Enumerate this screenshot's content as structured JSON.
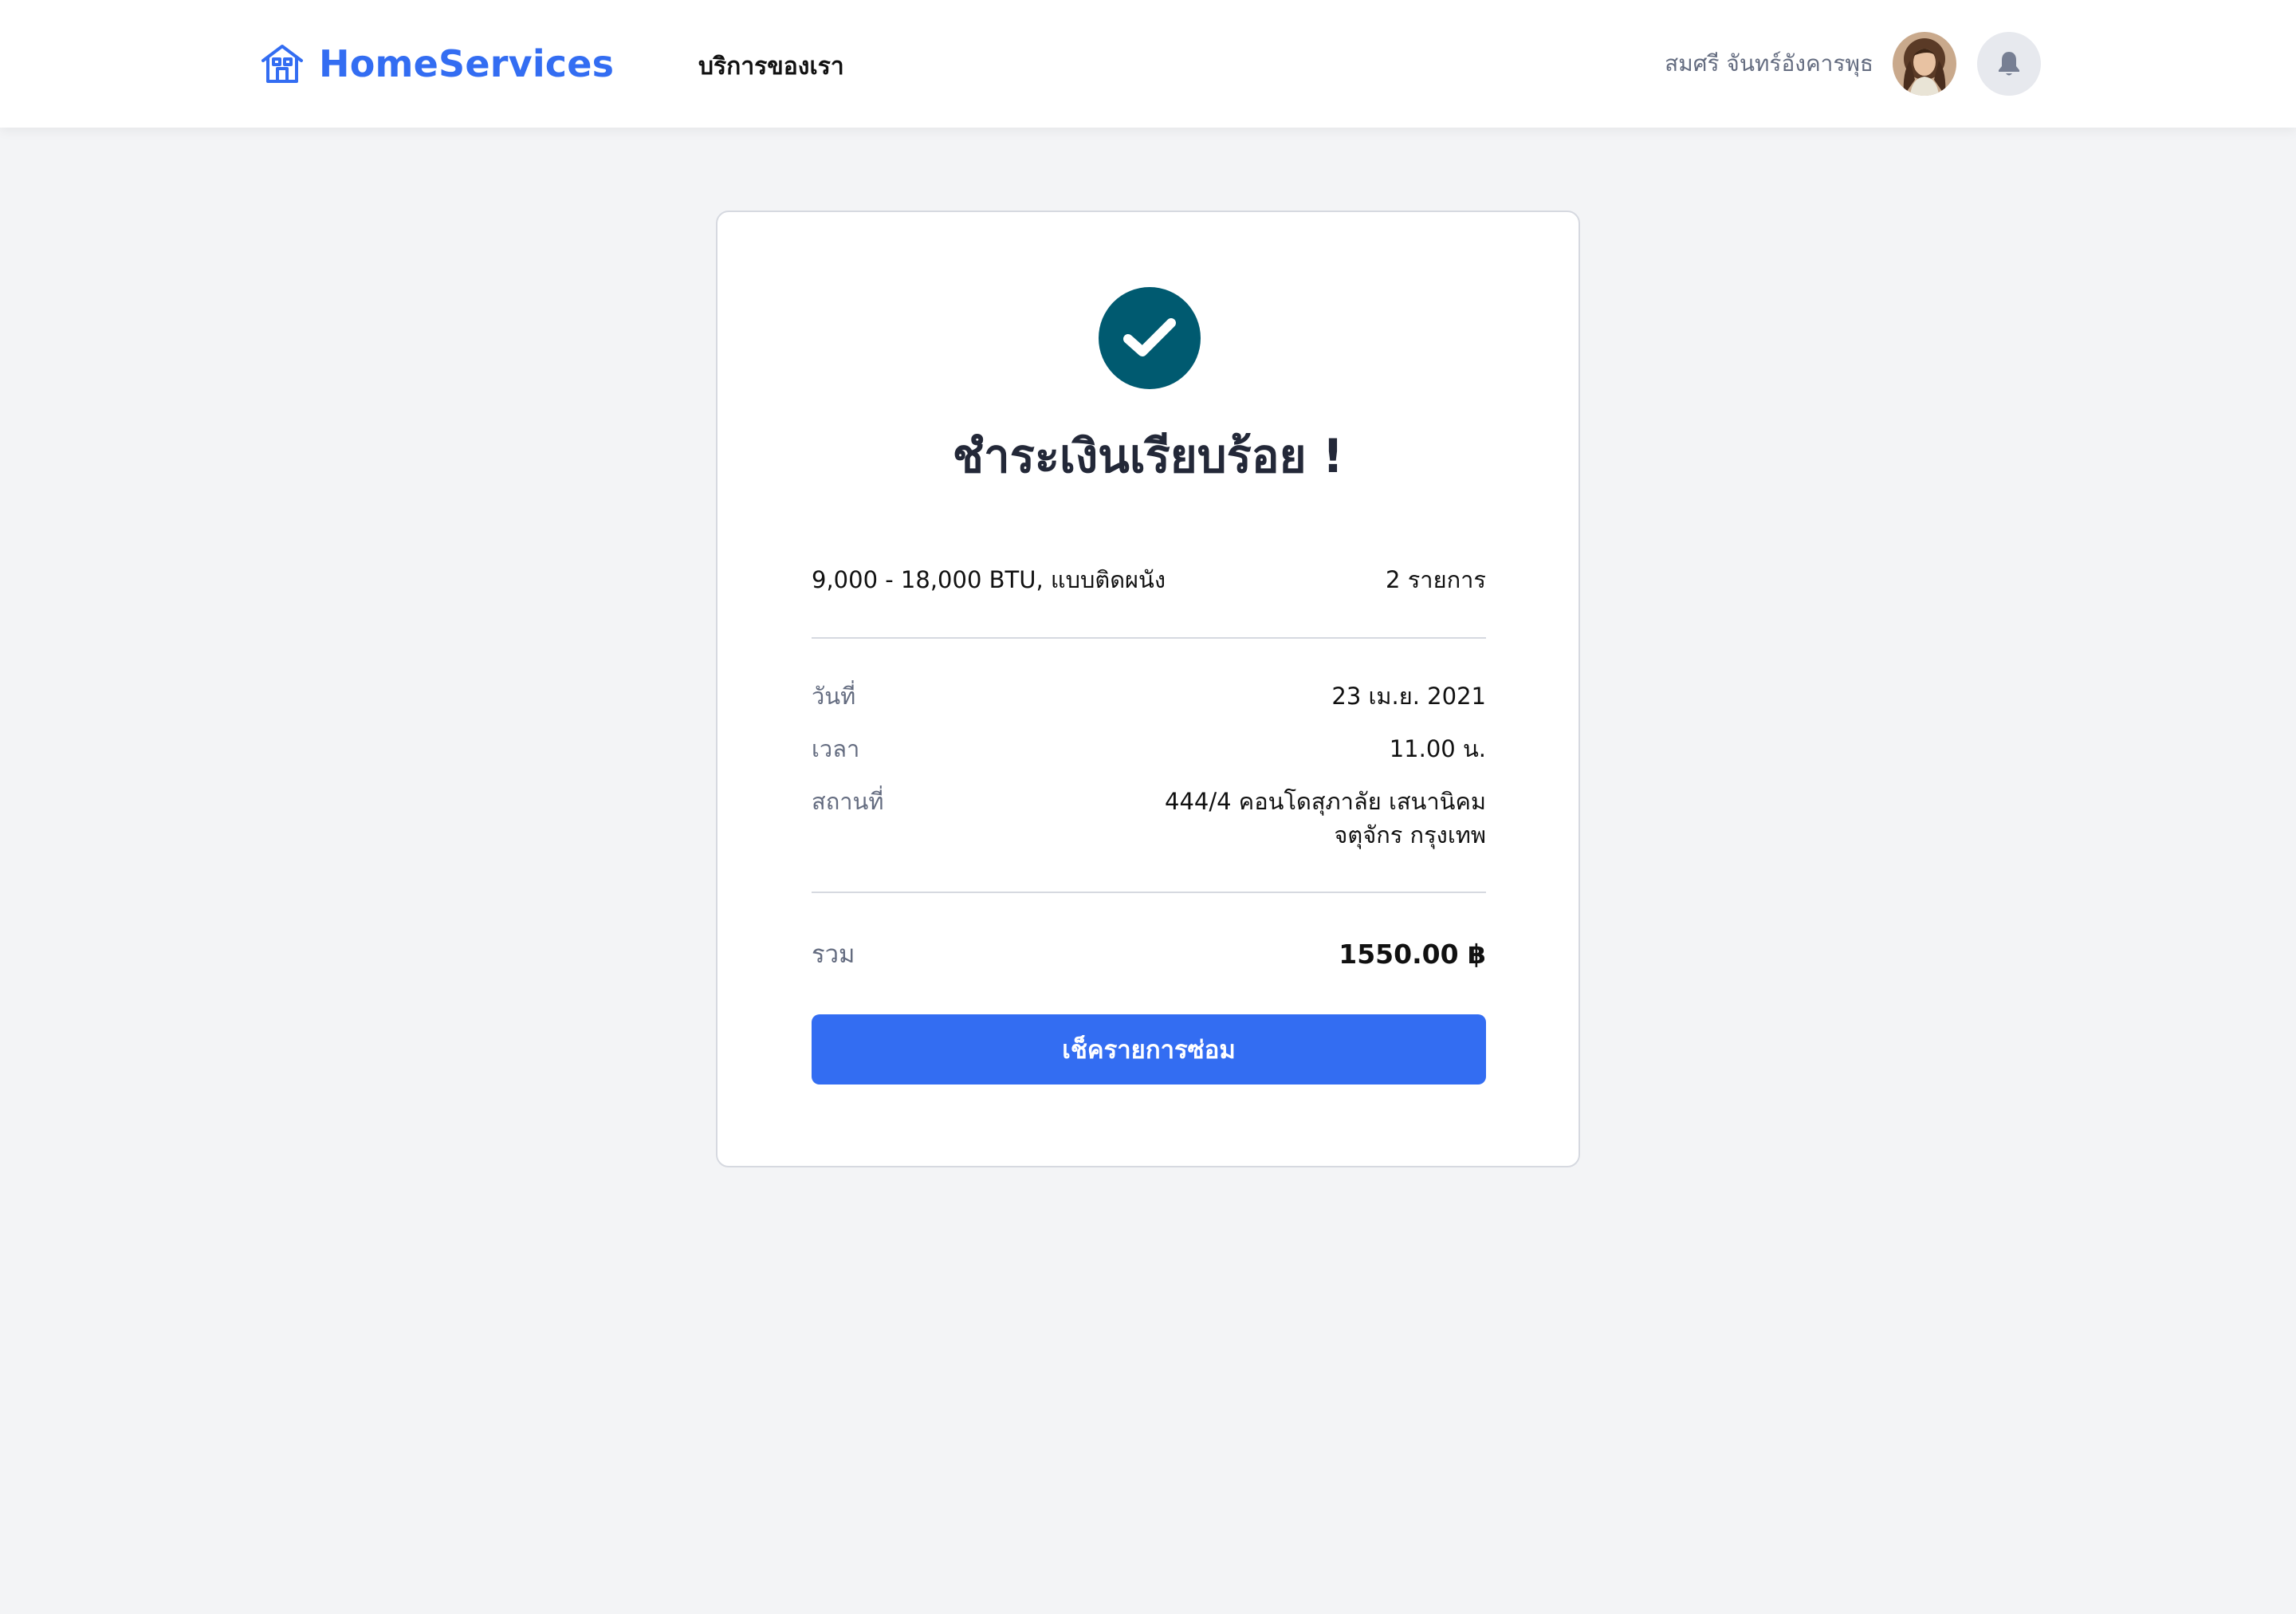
{
  "header": {
    "brand_name": "HomeServices",
    "brand_icon": "house-icon",
    "nav": {
      "services_label": "บริการของเรา"
    },
    "user": {
      "name": "สมศรี จันทร์อังคารพุธ",
      "avatar": "avatar",
      "notification_icon": "bell-icon"
    }
  },
  "receipt": {
    "status_icon": "check-circle-icon",
    "title": "ชำระเงินเรียบร้อย !",
    "item": {
      "name": "9,000 - 18,000 BTU, แบบติดผนัง",
      "quantity": "2 รายการ"
    },
    "details": {
      "date_label": "วันที่",
      "date_value": "23 เม.ย. 2021",
      "time_label": "เวลา",
      "time_value": "11.00 น.",
      "location_label": "สถานที่",
      "location_line1": "444/4 คอนโดสุภาลัย เสนานิคม",
      "location_line2": "จตุจักร กรุงเทพ"
    },
    "total": {
      "label": "รวม",
      "value": "1550.00 ฿"
    },
    "button_label": "เช็ครายการซ่อม"
  },
  "colors": {
    "brand": "#336df2",
    "success": "#005a70",
    "page_background": "#f3f4f6",
    "muted_text": "#646c80",
    "divider": "#d6d9e0"
  }
}
